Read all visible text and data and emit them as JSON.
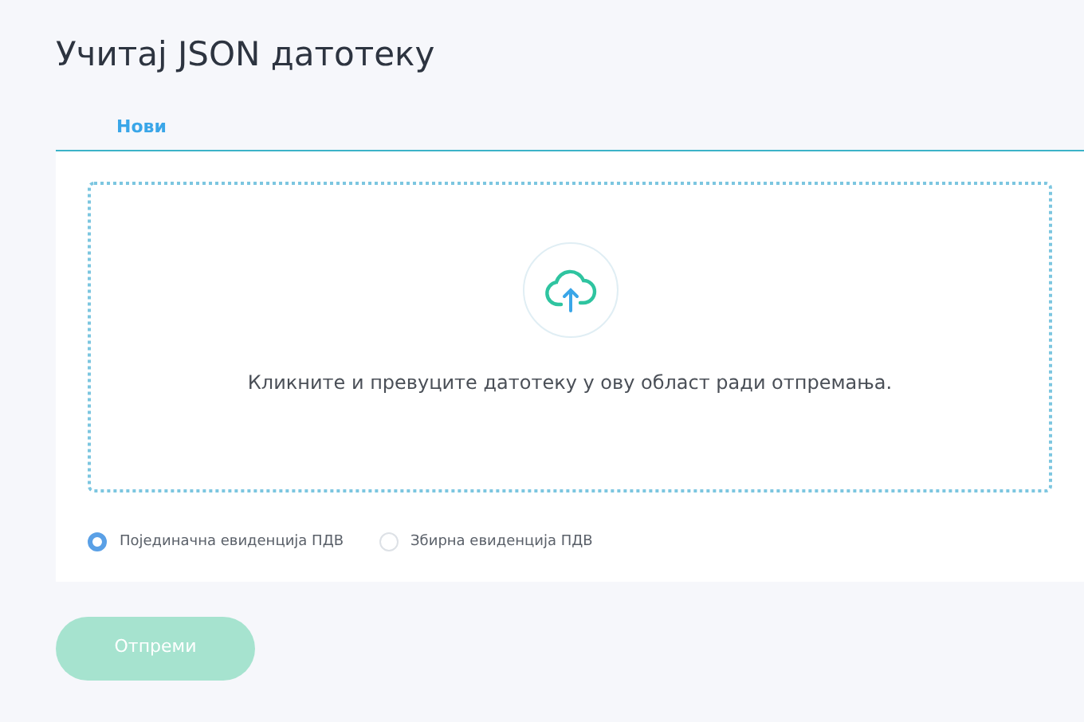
{
  "title": "Учитај JSON датотеку",
  "tabs": [
    {
      "label": "Нови",
      "selected": true
    }
  ],
  "dropzone": {
    "text": "Кликните и превуците датотеку у ову област ради отпремања."
  },
  "options": [
    {
      "label": "Појединачна евиденција ПДВ",
      "selected": true
    },
    {
      "label": "Збирна евиденција ПДВ",
      "selected": false
    }
  ],
  "submit": {
    "label": "Отпреми",
    "disabled": true
  }
}
